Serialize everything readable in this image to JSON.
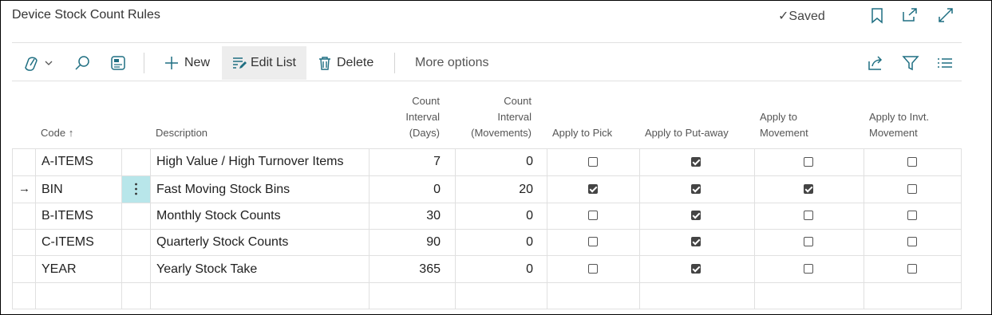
{
  "window": {
    "title": "Device Stock Count Rules",
    "saved_label": "Saved"
  },
  "toolbar": {
    "new_label": "New",
    "edit_list_label": "Edit List",
    "delete_label": "Delete",
    "more_options_label": "More options"
  },
  "table": {
    "headers": {
      "code": "Code",
      "description": "Description",
      "count_days_1": "Count",
      "count_days_2": "Interval",
      "count_days_3": "(Days)",
      "count_mov_1": "Count",
      "count_mov_2": "Interval",
      "count_mov_3": "(Movements)",
      "apply_pick": "Apply to Pick",
      "apply_putaway": "Apply to Put-away",
      "apply_movement_1": "Apply to",
      "apply_movement_2": "Movement",
      "apply_invt_1": "Apply to Invt.",
      "apply_invt_2": "Movement"
    },
    "rows": [
      {
        "code": "A-ITEMS",
        "description": "High Value / High Turnover Items",
        "days": "7",
        "movements": "0",
        "pick": false,
        "putaway": true,
        "movement": false,
        "invt": false
      },
      {
        "code": "BIN",
        "description": "Fast Moving Stock Bins",
        "days": "0",
        "movements": "20",
        "pick": true,
        "putaway": true,
        "movement": true,
        "invt": false
      },
      {
        "code": "B-ITEMS",
        "description": "Monthly Stock Counts",
        "days": "30",
        "movements": "0",
        "pick": false,
        "putaway": true,
        "movement": false,
        "invt": false
      },
      {
        "code": "C-ITEMS",
        "description": "Quarterly Stock Counts",
        "days": "90",
        "movements": "0",
        "pick": false,
        "putaway": true,
        "movement": false,
        "invt": false
      },
      {
        "code": "YEAR",
        "description": "Yearly Stock Take",
        "days": "365",
        "movements": "0",
        "pick": false,
        "putaway": true,
        "movement": false,
        "invt": false
      }
    ],
    "selected_row": 1
  },
  "icons": {
    "saved": "checkmark-icon",
    "bookmark": "bookmark-icon",
    "open_new": "open-in-new-window-icon",
    "expand": "expand-icon",
    "copilot": "copilot-icon",
    "search": "search-icon",
    "layout": "layout-icon",
    "new": "plus-icon",
    "edit_list": "edit-list-icon",
    "delete": "trash-icon",
    "share": "share-icon",
    "filter": "filter-icon",
    "list": "list-icon",
    "sort": "sort-ascending-icon",
    "row_marker": "arrow-right-icon",
    "row_menu": "more-vertical-icon"
  },
  "colors": {
    "accent": "#1f6f82",
    "selected_cell": "#b8e6ea",
    "edit_list_bg": "#ededed"
  }
}
